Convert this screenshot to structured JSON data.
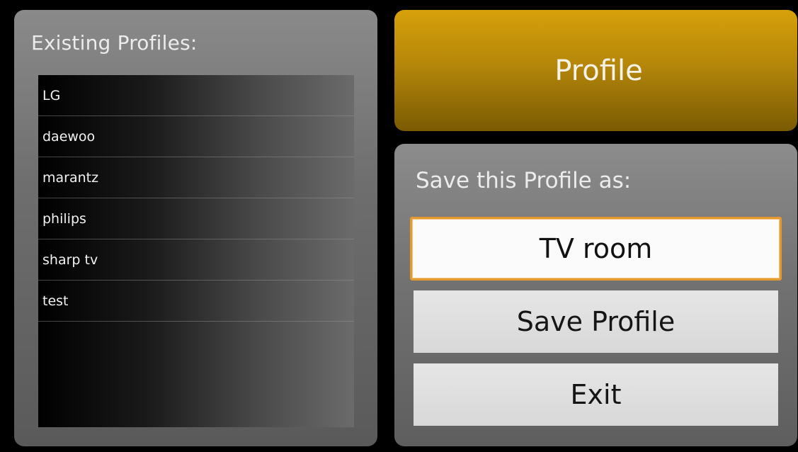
{
  "profiles_panel": {
    "label": "Existing Profiles:",
    "items": [
      {
        "label": "LG"
      },
      {
        "label": "daewoo"
      },
      {
        "label": "marantz"
      },
      {
        "label": "philips"
      },
      {
        "label": "sharp tv"
      },
      {
        "label": "test"
      }
    ]
  },
  "header": {
    "title": "Profile"
  },
  "save_panel": {
    "label": "Save this Profile as:",
    "name_input_value": "TV room",
    "save_button_label": "Save Profile",
    "exit_button_label": "Exit"
  },
  "colors": {
    "accent_gold": "#b5870a",
    "input_focus_border": "#e49a2e"
  }
}
